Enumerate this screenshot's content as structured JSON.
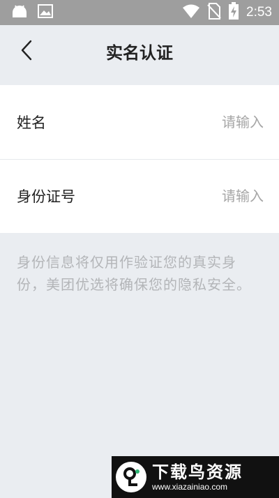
{
  "status_bar": {
    "time": "2:53",
    "icons": [
      "android-icon",
      "image-icon",
      "wifi-icon",
      "no-sim-icon",
      "battery-charging-icon"
    ]
  },
  "header": {
    "title": "实名认证",
    "back_icon": "back-chevron-icon"
  },
  "form": {
    "name": {
      "label": "姓名",
      "placeholder": "请输入",
      "value": ""
    },
    "id_number": {
      "label": "身份证号",
      "placeholder": "请输入",
      "value": ""
    }
  },
  "notice": "身份信息将仅用作验证您的真实身份，美团优选将确保您的隐私安全。",
  "watermark": {
    "title": "下载鸟资源",
    "url": "www.xiazainiao.com"
  },
  "colors": {
    "background": "#eaedf1",
    "status_bar": "#9e9e9e",
    "text": "#222222",
    "placeholder": "#a6a6a6",
    "notice": "#b3b5b8"
  }
}
